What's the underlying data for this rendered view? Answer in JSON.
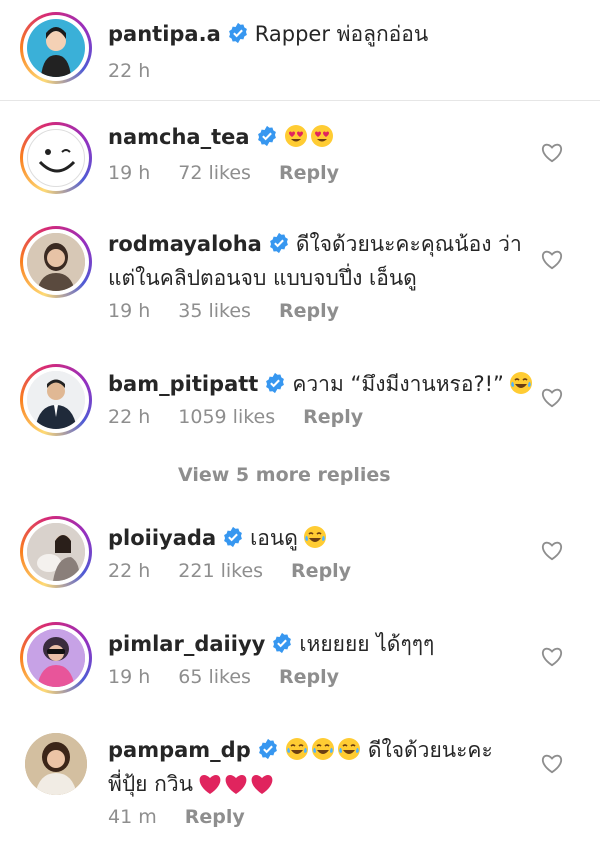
{
  "colors": {
    "verified": "#3797f0",
    "text": "#262626",
    "muted": "#8e8e8e",
    "heart_red": "#e0245e"
  },
  "comments": [
    {
      "username": "pantipa.a",
      "text": "Rapper พ่อลูกอ่อน",
      "time": "22 h",
      "likes": "",
      "reply": "",
      "emoji": []
    },
    {
      "username": "namcha_tea",
      "text": "",
      "time": "19 h",
      "likes": "72 likes",
      "reply": "Reply",
      "emoji": [
        "heart-eyes",
        "heart-eyes"
      ]
    },
    {
      "username": "rodmayaloha",
      "text": "ดีใจด้วยนะคะคุณน้อง ว่า",
      "text2": "แต่ในคลิปตอนจบ แบบจบปึ่ง เอ็นดู",
      "time": "19 h",
      "likes": "35 likes",
      "reply": "Reply",
      "emoji": []
    },
    {
      "username": "bam_pitipatt",
      "text": "ความ “มึงมีงานหรอ?!”",
      "time": "22 h",
      "likes": "1059 likes",
      "reply": "Reply",
      "emoji": [
        "joy"
      ]
    },
    {
      "username": "ploiiyada",
      "text": "เอนดู",
      "time": "22 h",
      "likes": "221 likes",
      "reply": "Reply",
      "emoji": [
        "joy"
      ]
    },
    {
      "username": "pimlar_daiiyy",
      "text": "เหยยยย ได้ๆๆๆ",
      "time": "19 h",
      "likes": "65 likes",
      "reply": "Reply",
      "emoji": []
    },
    {
      "username": "pampam_dp",
      "text": "ดีใจด้วยนะคะ",
      "text2": "พี่ปุ้ย กวิน",
      "time": "41 m",
      "likes": "",
      "reply": "Reply",
      "emoji": [
        "joy",
        "joy",
        "joy"
      ],
      "emoji2": [
        "red-heart",
        "red-heart",
        "red-heart"
      ]
    }
  ],
  "view_more": "View 5 more replies"
}
